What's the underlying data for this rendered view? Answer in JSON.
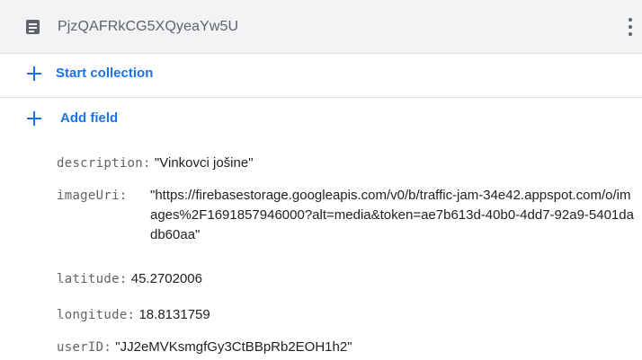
{
  "document": {
    "id": "PjzQAFRkCG5XQyeaYw5U",
    "icon": "document-icon",
    "menu_icon": "more-vert-icon"
  },
  "actions": {
    "start_collection": "Start collection",
    "add_field": "Add field"
  },
  "fields": [
    {
      "key": "description:",
      "value": "\"Vinkovci jošine\""
    },
    {
      "key": "imageUri:",
      "value": "\"https://firebasestorage.googleapis.com/v0/b/traffic-jam-34e42.appspot.com/o/images%2F1691857946000?alt=media&token=ae7b613d-40b0-4dd7-92a9-5401dadb60aa\""
    },
    {
      "key": "latitude:",
      "value": "45.2702006"
    },
    {
      "key": "longitude:",
      "value": "18.8131759"
    },
    {
      "key": "userID:",
      "value": "\"JJ2eMVKsmgfGy3CtBBpRb2EOH1h2\""
    }
  ],
  "colors": {
    "accent": "#1a73e8",
    "header_bg": "#f1f3f4",
    "key_text": "#5f6368",
    "value_text": "#202124"
  }
}
